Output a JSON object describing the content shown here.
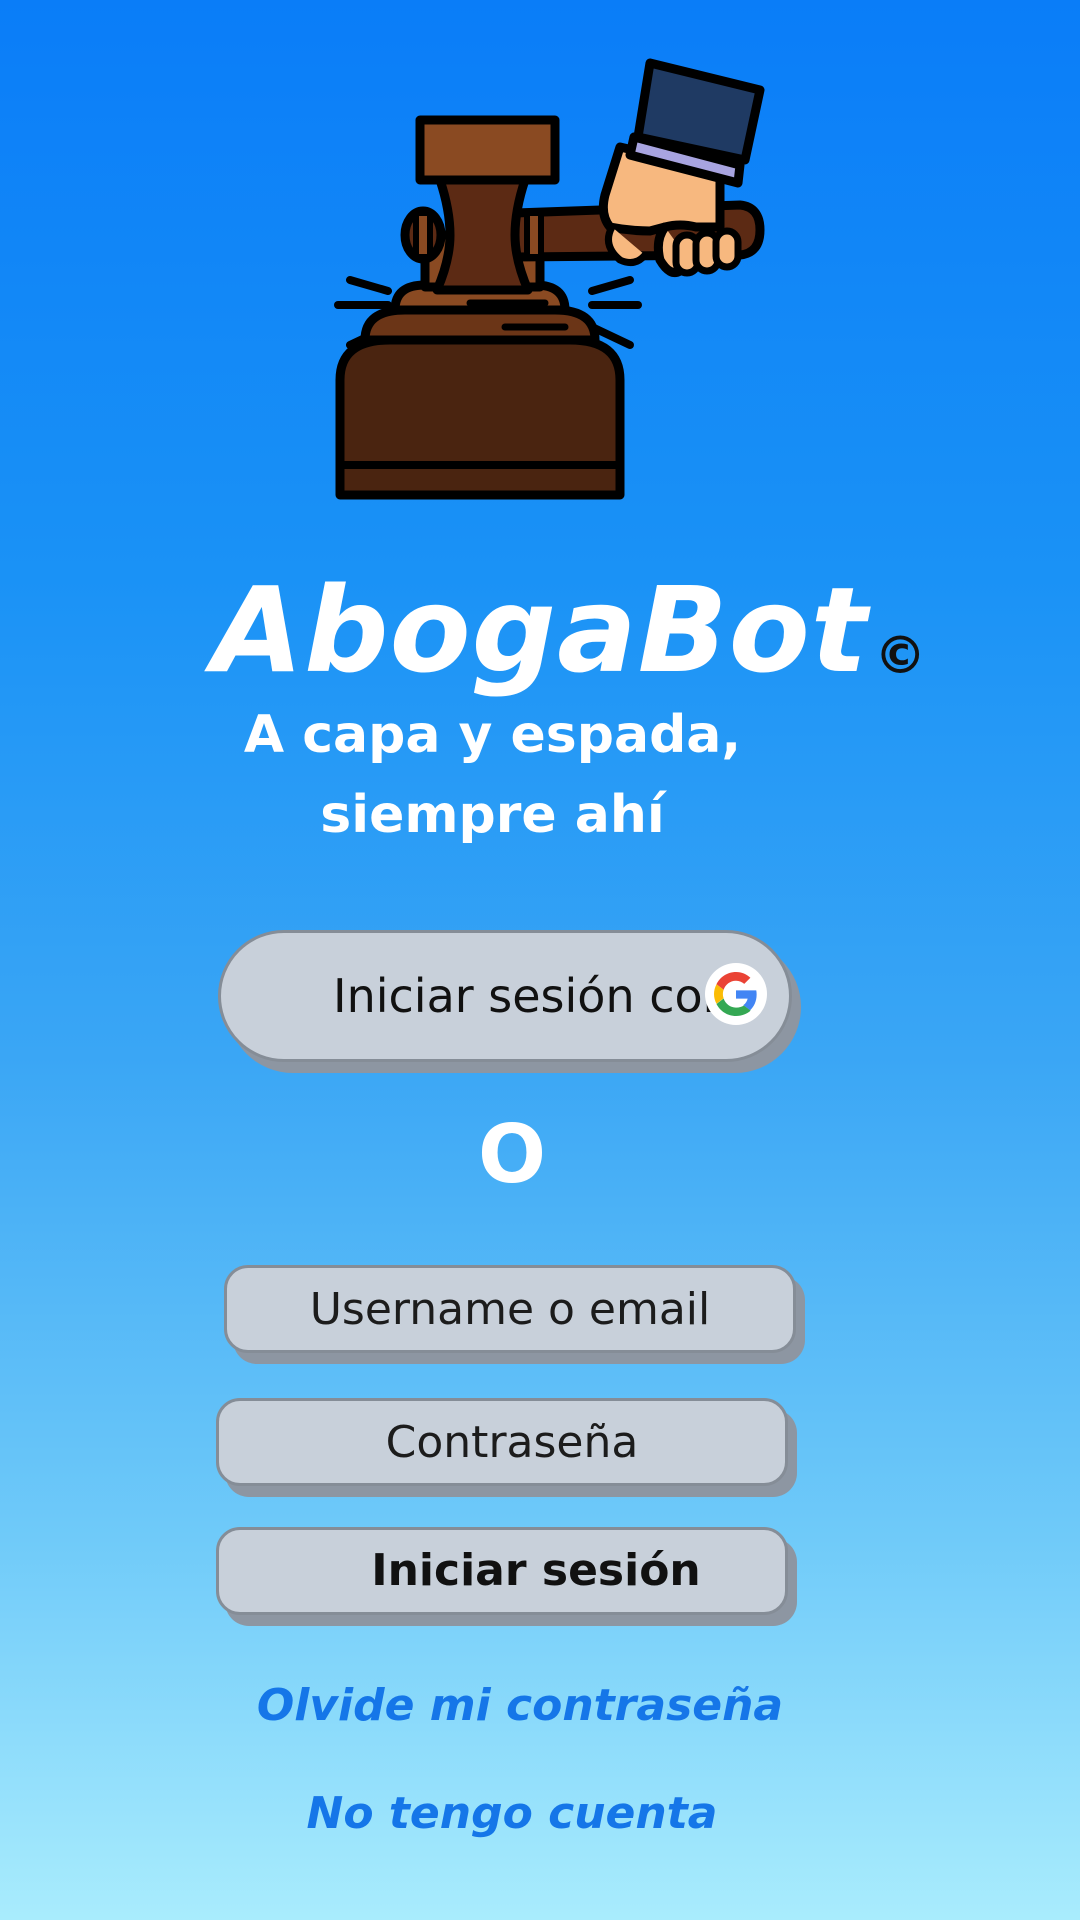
{
  "app": {
    "title": "AbogaBot",
    "copyright_symbol": "©",
    "tagline_line1": "A capa y espada,",
    "tagline_line2": "siempre ahí",
    "logo_icon": "gavel-icon"
  },
  "login": {
    "google_label": "Iniciar sesión con",
    "google_icon": "google-icon",
    "or_separator": "O",
    "username_placeholder": "Username o email",
    "password_placeholder": "Contraseña",
    "submit_label": "Iniciar sesión",
    "forgot_link": "Olvide mi contraseña",
    "no_account_link": "No tengo cuenta"
  },
  "colors": {
    "background_top": "#0a7df8",
    "background_bottom": "#a9ecfd",
    "button_fill": "#c8d0da",
    "button_shadow": "#8d96a2",
    "link": "#1576e8",
    "text_light": "#ffffff"
  }
}
